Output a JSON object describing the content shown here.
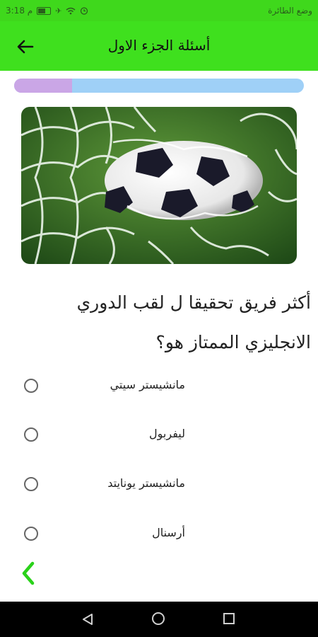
{
  "status_bar": {
    "time": "3:18 م",
    "mode_text": "وضع الطائرة",
    "icons": [
      "battery-icon",
      "airplane-icon",
      "wifi-icon",
      "alarm-icon"
    ]
  },
  "app_bar": {
    "title": "أسئلة الجزء الاول",
    "back_icon": "arrow-left-icon",
    "background": "#3fe01e"
  },
  "progress": {
    "value": 0.2,
    "fill_color": "#caa6e6",
    "track_color": "#9fd0f7"
  },
  "hero_image": {
    "subject": "soccer ball in goal net"
  },
  "question": {
    "text": "أكثر فريق تحقيقا ل لقب الدوري الانجليزي الممتاز هو؟"
  },
  "options": [
    {
      "label": "مانشيستر سيتي",
      "selected": false
    },
    {
      "label": "ليفربول",
      "selected": false
    },
    {
      "label": "مانشيستر يونايتد",
      "selected": false
    },
    {
      "label": "أرسنال",
      "selected": false
    }
  ],
  "footer": {
    "prev_icon": "chevron-left-icon",
    "accent": "#2ad21a"
  },
  "nav_bar": {
    "icons": [
      "nav-back-icon",
      "nav-home-icon",
      "nav-recent-icon"
    ]
  }
}
